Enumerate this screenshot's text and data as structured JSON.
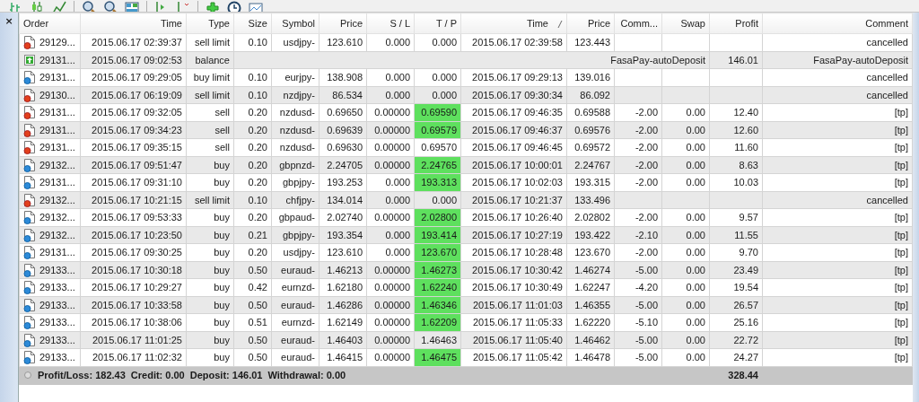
{
  "table": {
    "columns": [
      {
        "label": "Order",
        "sorted": false
      },
      {
        "label": "Time",
        "sorted": false
      },
      {
        "label": "Type",
        "sorted": false
      },
      {
        "label": "Size",
        "sorted": false
      },
      {
        "label": "Symbol",
        "sorted": false
      },
      {
        "label": "Price",
        "sorted": false
      },
      {
        "label": "S / L",
        "sorted": false
      },
      {
        "label": "T / P",
        "sorted": false
      },
      {
        "label": "Time",
        "sorted": true
      },
      {
        "label": "Price",
        "sorted": false
      },
      {
        "label": "Comm...",
        "sorted": false
      },
      {
        "label": "Swap",
        "sorted": false
      },
      {
        "label": "Profit",
        "sorted": false
      },
      {
        "label": "Comment",
        "sorted": false
      }
    ],
    "rows": [
      {
        "kind": "sell",
        "order": "29129...",
        "time": "2015.06.17 02:39:37",
        "type": "sell limit",
        "size": "0.10",
        "symbol": "usdjpy-",
        "price": "123.610",
        "sl": "0.000",
        "tp": "0.000",
        "tp_hit": false,
        "close_time": "2015.06.17 02:39:58",
        "close_price": "123.443",
        "comment": "cancelled"
      },
      {
        "kind": "balance",
        "order": "29131...",
        "time": "2015.06.17 09:02:53",
        "type": "balance",
        "note": "FasaPay-autoDeposit",
        "profit": "146.01",
        "comment": "FasaPay-autoDeposit"
      },
      {
        "kind": "buy",
        "order": "29131...",
        "time": "2015.06.17 09:29:05",
        "type": "buy limit",
        "size": "0.10",
        "symbol": "eurjpy-",
        "price": "138.908",
        "sl": "0.000",
        "tp": "0.000",
        "tp_hit": false,
        "close_time": "2015.06.17 09:29:13",
        "close_price": "139.016",
        "comment": "cancelled"
      },
      {
        "kind": "sell",
        "order": "29130...",
        "time": "2015.06.17 06:19:09",
        "type": "sell limit",
        "size": "0.10",
        "symbol": "nzdjpy-",
        "price": "86.534",
        "sl": "0.000",
        "tp": "0.000",
        "tp_hit": false,
        "close_time": "2015.06.17 09:30:34",
        "close_price": "86.092",
        "comment": "cancelled"
      },
      {
        "kind": "sell",
        "order": "29131...",
        "time": "2015.06.17 09:32:05",
        "type": "sell",
        "size": "0.20",
        "symbol": "nzdusd-",
        "price": "0.69650",
        "sl": "0.00000",
        "tp": "0.69590",
        "tp_hit": true,
        "close_time": "2015.06.17 09:46:35",
        "close_price": "0.69588",
        "commission": "-2.00",
        "swap": "0.00",
        "profit": "12.40",
        "comment": "[tp]"
      },
      {
        "kind": "sell",
        "order": "29131...",
        "time": "2015.06.17 09:34:23",
        "type": "sell",
        "size": "0.20",
        "symbol": "nzdusd-",
        "price": "0.69639",
        "sl": "0.00000",
        "tp": "0.69579",
        "tp_hit": true,
        "close_time": "2015.06.17 09:46:37",
        "close_price": "0.69576",
        "commission": "-2.00",
        "swap": "0.00",
        "profit": "12.60",
        "comment": "[tp]"
      },
      {
        "kind": "sell",
        "order": "29131...",
        "time": "2015.06.17 09:35:15",
        "type": "sell",
        "size": "0.20",
        "symbol": "nzdusd-",
        "price": "0.69630",
        "sl": "0.00000",
        "tp": "0.69570",
        "tp_hit": false,
        "close_time": "2015.06.17 09:46:45",
        "close_price": "0.69572",
        "commission": "-2.00",
        "swap": "0.00",
        "profit": "11.60",
        "comment": "[tp]"
      },
      {
        "kind": "buy",
        "order": "29132...",
        "time": "2015.06.17 09:51:47",
        "type": "buy",
        "size": "0.20",
        "symbol": "gbpnzd-",
        "price": "2.24705",
        "sl": "0.00000",
        "tp": "2.24765",
        "tp_hit": true,
        "close_time": "2015.06.17 10:00:01",
        "close_price": "2.24767",
        "commission": "-2.00",
        "swap": "0.00",
        "profit": "8.63",
        "comment": "[tp]"
      },
      {
        "kind": "buy",
        "order": "29131...",
        "time": "2015.06.17 09:31:10",
        "type": "buy",
        "size": "0.20",
        "symbol": "gbpjpy-",
        "price": "193.253",
        "sl": "0.000",
        "tp": "193.313",
        "tp_hit": true,
        "close_time": "2015.06.17 10:02:03",
        "close_price": "193.315",
        "commission": "-2.00",
        "swap": "0.00",
        "profit": "10.03",
        "comment": "[tp]"
      },
      {
        "kind": "sell",
        "order": "29132...",
        "time": "2015.06.17 10:21:15",
        "type": "sell limit",
        "size": "0.10",
        "symbol": "chfjpy-",
        "price": "134.014",
        "sl": "0.000",
        "tp": "0.000",
        "tp_hit": false,
        "close_time": "2015.06.17 10:21:37",
        "close_price": "133.496",
        "comment": "cancelled"
      },
      {
        "kind": "buy",
        "order": "29132...",
        "time": "2015.06.17 09:53:33",
        "type": "buy",
        "size": "0.20",
        "symbol": "gbpaud-",
        "price": "2.02740",
        "sl": "0.00000",
        "tp": "2.02800",
        "tp_hit": true,
        "close_time": "2015.06.17 10:26:40",
        "close_price": "2.02802",
        "commission": "-2.00",
        "swap": "0.00",
        "profit": "9.57",
        "comment": "[tp]"
      },
      {
        "kind": "buy",
        "order": "29132...",
        "time": "2015.06.17 10:23:50",
        "type": "buy",
        "size": "0.21",
        "symbol": "gbpjpy-",
        "price": "193.354",
        "sl": "0.000",
        "tp": "193.414",
        "tp_hit": true,
        "close_time": "2015.06.17 10:27:19",
        "close_price": "193.422",
        "commission": "-2.10",
        "swap": "0.00",
        "profit": "11.55",
        "comment": "[tp]"
      },
      {
        "kind": "buy",
        "order": "29131...",
        "time": "2015.06.17 09:30:25",
        "type": "buy",
        "size": "0.20",
        "symbol": "usdjpy-",
        "price": "123.610",
        "sl": "0.000",
        "tp": "123.670",
        "tp_hit": true,
        "close_time": "2015.06.17 10:28:48",
        "close_price": "123.670",
        "commission": "-2.00",
        "swap": "0.00",
        "profit": "9.70",
        "comment": "[tp]"
      },
      {
        "kind": "buy",
        "order": "29133...",
        "time": "2015.06.17 10:30:18",
        "type": "buy",
        "size": "0.50",
        "symbol": "euraud-",
        "price": "1.46213",
        "sl": "0.00000",
        "tp": "1.46273",
        "tp_hit": true,
        "close_time": "2015.06.17 10:30:42",
        "close_price": "1.46274",
        "commission": "-5.00",
        "swap": "0.00",
        "profit": "23.49",
        "comment": "[tp]"
      },
      {
        "kind": "buy",
        "order": "29133...",
        "time": "2015.06.17 10:29:27",
        "type": "buy",
        "size": "0.42",
        "symbol": "eurnzd-",
        "price": "1.62180",
        "sl": "0.00000",
        "tp": "1.62240",
        "tp_hit": true,
        "close_time": "2015.06.17 10:30:49",
        "close_price": "1.62247",
        "commission": "-4.20",
        "swap": "0.00",
        "profit": "19.54",
        "comment": "[tp]"
      },
      {
        "kind": "buy",
        "order": "29133...",
        "time": "2015.06.17 10:33:58",
        "type": "buy",
        "size": "0.50",
        "symbol": "euraud-",
        "price": "1.46286",
        "sl": "0.00000",
        "tp": "1.46346",
        "tp_hit": true,
        "close_time": "2015.06.17 11:01:03",
        "close_price": "1.46355",
        "commission": "-5.00",
        "swap": "0.00",
        "profit": "26.57",
        "comment": "[tp]"
      },
      {
        "kind": "buy",
        "order": "29133...",
        "time": "2015.06.17 10:38:06",
        "type": "buy",
        "size": "0.51",
        "symbol": "eurnzd-",
        "price": "1.62149",
        "sl": "0.00000",
        "tp": "1.62209",
        "tp_hit": true,
        "close_time": "2015.06.17 11:05:33",
        "close_price": "1.62220",
        "commission": "-5.10",
        "swap": "0.00",
        "profit": "25.16",
        "comment": "[tp]"
      },
      {
        "kind": "buy",
        "order": "29133...",
        "time": "2015.06.17 11:01:25",
        "type": "buy",
        "size": "0.50",
        "symbol": "euraud-",
        "price": "1.46403",
        "sl": "0.00000",
        "tp": "1.46463",
        "tp_hit": false,
        "close_time": "2015.06.17 11:05:40",
        "close_price": "1.46462",
        "commission": "-5.00",
        "swap": "0.00",
        "profit": "22.72",
        "comment": "[tp]"
      },
      {
        "kind": "buy",
        "order": "29133...",
        "time": "2015.06.17 11:02:32",
        "type": "buy",
        "size": "0.50",
        "symbol": "euraud-",
        "price": "1.46415",
        "sl": "0.00000",
        "tp": "1.46475",
        "tp_hit": true,
        "close_time": "2015.06.17 11:05:42",
        "close_price": "1.46478",
        "commission": "-5.00",
        "swap": "0.00",
        "profit": "24.27",
        "comment": "[tp]"
      }
    ],
    "summary": {
      "items": [
        "Profit/Loss: 182.43",
        "Credit: 0.00",
        "Deposit: 146.01",
        "Withdrawal: 0.00"
      ],
      "total": "328.44"
    }
  },
  "close_button": "×"
}
